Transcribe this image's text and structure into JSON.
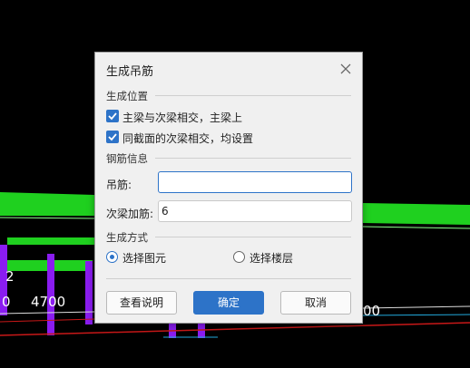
{
  "cad": {
    "dimension_left": "4700",
    "dimension_left_prefix": "0",
    "dimension_right": "00",
    "marker": "2"
  },
  "dialog": {
    "title": "生成吊筋",
    "section_position": "生成位置",
    "check1_label": "主梁与次梁相交，主梁上",
    "check1_checked": true,
    "check2_label": "同截面的次梁相交，均设置",
    "check2_checked": true,
    "section_rebar": "钢筋信息",
    "hanger_label": "吊筋:",
    "hanger_value": "",
    "secondary_label": "次梁加筋:",
    "secondary_value": "6",
    "section_method": "生成方式",
    "radio1_label": "选择图元",
    "radio1_selected": true,
    "radio2_label": "选择楼层",
    "radio2_selected": false,
    "btn_help": "查看说明",
    "btn_ok": "确定",
    "btn_cancel": "取消"
  },
  "colors": {
    "accent": "#2d73c8",
    "cad_green": "#1fd01f",
    "cad_purple": "#8a1cf0",
    "cad_red": "#c81818"
  }
}
